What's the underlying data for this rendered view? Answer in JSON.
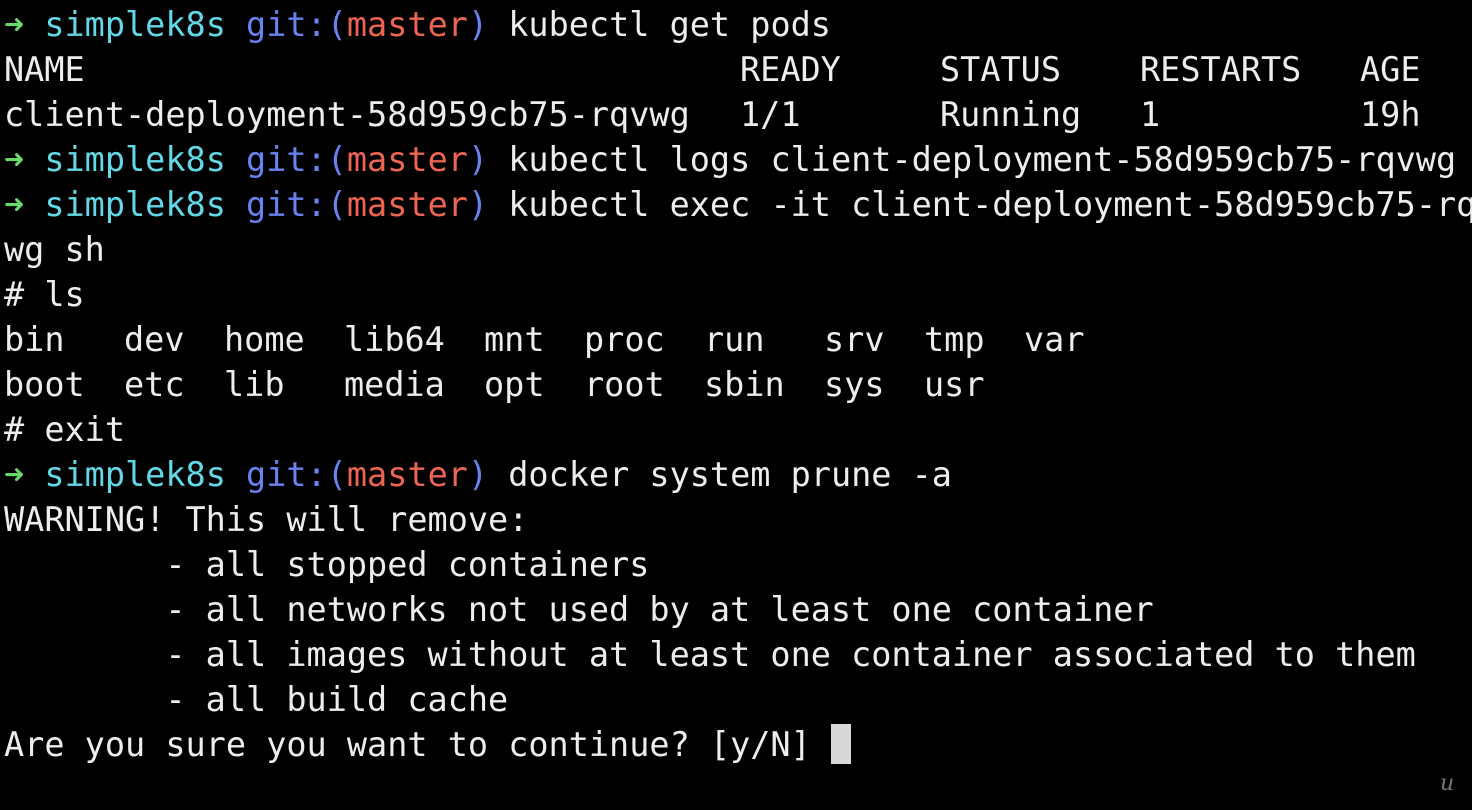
{
  "prompt": {
    "arrow": "➜",
    "dir": "simplek8s",
    "git_prefix": "git:(",
    "branch": "master",
    "git_suffix": ")"
  },
  "commands": {
    "get_pods": "kubectl get pods",
    "logs": "kubectl logs client-deployment-58d959cb75-rqvwg",
    "exec": "kubectl exec -it client-deployment-58d959cb75-rq",
    "exec_wrap": "wg sh",
    "docker_prune": "docker system prune -a"
  },
  "pods_table": {
    "headers": [
      "NAME",
      "READY",
      "STATUS",
      "RESTARTS",
      "AGE"
    ],
    "rows": [
      [
        "client-deployment-58d959cb75-rqvwg",
        "1/1",
        "Running",
        "1",
        "19h"
      ]
    ]
  },
  "shell": {
    "ls_cmd": "# ls",
    "ls_rows": [
      [
        "bin",
        "dev",
        "home",
        "lib64",
        "mnt",
        "proc",
        "run",
        "srv",
        "tmp",
        "var"
      ],
      [
        "boot",
        "etc",
        "lib",
        "media",
        "opt",
        "root",
        "sbin",
        "sys",
        "usr"
      ]
    ],
    "exit_cmd": "# exit"
  },
  "prune_output": {
    "warning": "WARNING! This will remove:",
    "items": [
      "        - all stopped containers",
      "        - all networks not used by at least one container",
      "        - all images without at least one container associated to them",
      "        - all build cache"
    ],
    "confirm": "Are you sure you want to continue? [y/N] "
  },
  "watermark": "u",
  "colors": {
    "background": "#000000",
    "text": "#ededed",
    "arrow": "#69d96b",
    "dir": "#62d8e6",
    "git": "#6a82f0",
    "branch": "#ec6453"
  }
}
